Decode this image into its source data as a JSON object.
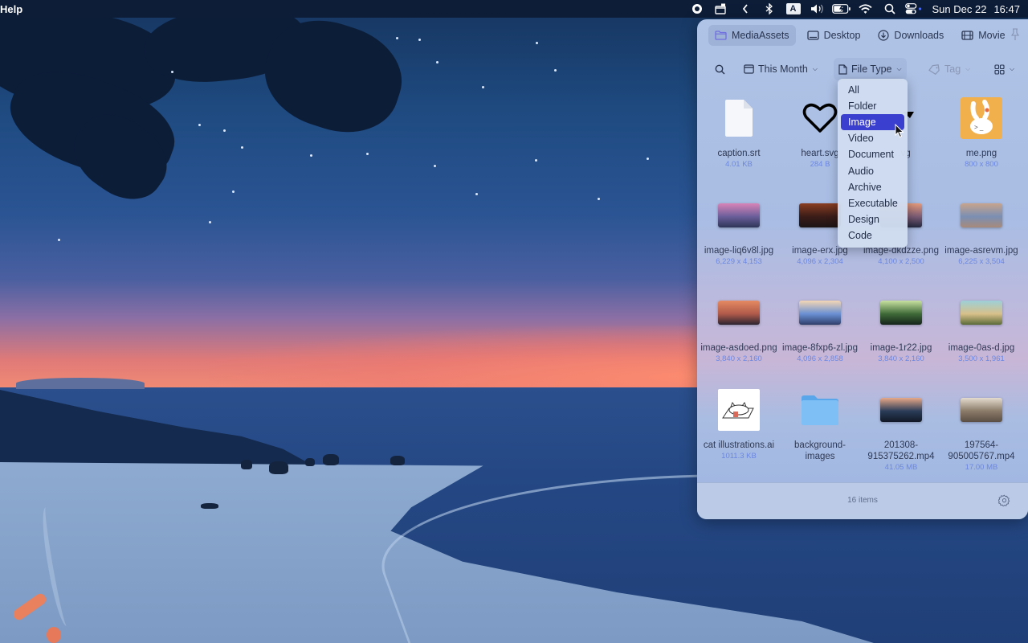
{
  "menubar": {
    "app_menu": "Help",
    "status_icons": [
      "record-icon",
      "screenshot-folder-icon",
      "chevron-left-icon",
      "bluetooth-icon",
      "input-source-icon",
      "volume-icon",
      "battery-charging-icon",
      "wifi-icon",
      "spotlight-search-icon",
      "control-center-icon"
    ],
    "input_source_label": "A",
    "date": "Sun Dec 22",
    "time": "16:47"
  },
  "panel": {
    "tabs": [
      {
        "label": "MediaAssets",
        "icon": "folder-icon",
        "active": true
      },
      {
        "label": "Desktop",
        "icon": "desktop-icon",
        "active": false
      },
      {
        "label": "Downloads",
        "icon": "download-icon",
        "active": false
      },
      {
        "label": "Movie",
        "icon": "film-icon",
        "active": false
      }
    ],
    "pin_icon": "pin-icon",
    "toolbar": {
      "search_icon": "search-icon",
      "date_filter": "This Month",
      "type_filter": "File Type",
      "tag_filter": "Tag",
      "view_icon": "grid-view-icon"
    },
    "files": [
      {
        "name": "caption.srt",
        "meta": "4.01 KB",
        "kind": "document"
      },
      {
        "name": "heart.svg",
        "meta": "284 B",
        "kind": "svg-heart"
      },
      {
        "name": "…vg",
        "meta": "",
        "kind": "svg-triangle"
      },
      {
        "name": "me.png",
        "meta": "800 x 800",
        "kind": "bunny"
      },
      {
        "name": "image-liq6v8l.jpg",
        "meta": "6,229 x 4,153",
        "kind": "photo"
      },
      {
        "name": "image-erx.jpg",
        "meta": "4,096 x 2,304",
        "kind": "photo"
      },
      {
        "name": "image-dkdzze.png",
        "meta": "4,100 x 2,500",
        "kind": "photo"
      },
      {
        "name": "image-asrevm.jpg",
        "meta": "6,225 x 3,504",
        "kind": "photo"
      },
      {
        "name": "image-asdoed.png",
        "meta": "3,840 x 2,160",
        "kind": "photo"
      },
      {
        "name": "image-8fxp6-zl.jpg",
        "meta": "4,096 x 2,858",
        "kind": "photo"
      },
      {
        "name": "image-1r22.jpg",
        "meta": "3,840 x 2,160",
        "kind": "photo"
      },
      {
        "name": "image-0as-d.jpg",
        "meta": "3,500 x 1,961",
        "kind": "photo"
      },
      {
        "name": "cat illustrations.ai",
        "meta": "1011.3 KB",
        "kind": "illustration"
      },
      {
        "name": "background-images",
        "meta": "",
        "kind": "folder"
      },
      {
        "name": "201308-915375262.mp4",
        "meta": "41.05 MB",
        "kind": "video"
      },
      {
        "name": "197564-905005767.mp4",
        "meta": "17.00 MB",
        "kind": "video"
      }
    ],
    "thumb_colors": {
      "image-liq6v8l.jpg": [
        "#d884b8",
        "#6a5e9a",
        "#2e3558"
      ],
      "image-erx.jpg": [
        "#8a3e22",
        "#3a1c18",
        "#1c1414"
      ],
      "image-dkdzze.png": [
        "#e59a7a",
        "#7a5a74",
        "#23273e"
      ],
      "image-asrevm.jpg": [
        "#c8a48c",
        "#7a8fb4",
        "#a88a7a"
      ],
      "image-asdoed.png": [
        "#e58a62",
        "#b05a4a",
        "#2a2430"
      ],
      "image-8fxp6-zl.jpg": [
        "#f4d6b4",
        "#6a90d4",
        "#2f3e6a"
      ],
      "image-1r22.jpg": [
        "#c9e2a0",
        "#3f6a38",
        "#15241a"
      ],
      "image-0as-d.jpg": [
        "#9ed0d8",
        "#d8c08a",
        "#5b6a3a"
      ],
      "201308-915375262.mp4": [
        "#e7a888",
        "#2a3c58",
        "#111826"
      ],
      "197564-905005767.mp4": [
        "#e4dccf",
        "#8a7a68",
        "#5a4e44"
      ]
    },
    "footer": {
      "item_count": "16 items",
      "settings_icon": "gear-icon"
    }
  },
  "file_type_menu": {
    "options": [
      "All",
      "Folder",
      "Image",
      "Video",
      "Document",
      "Audio",
      "Archive",
      "Executable",
      "Design",
      "Code"
    ],
    "highlighted": "Image",
    "highlight_color": "#3b3fd0"
  }
}
